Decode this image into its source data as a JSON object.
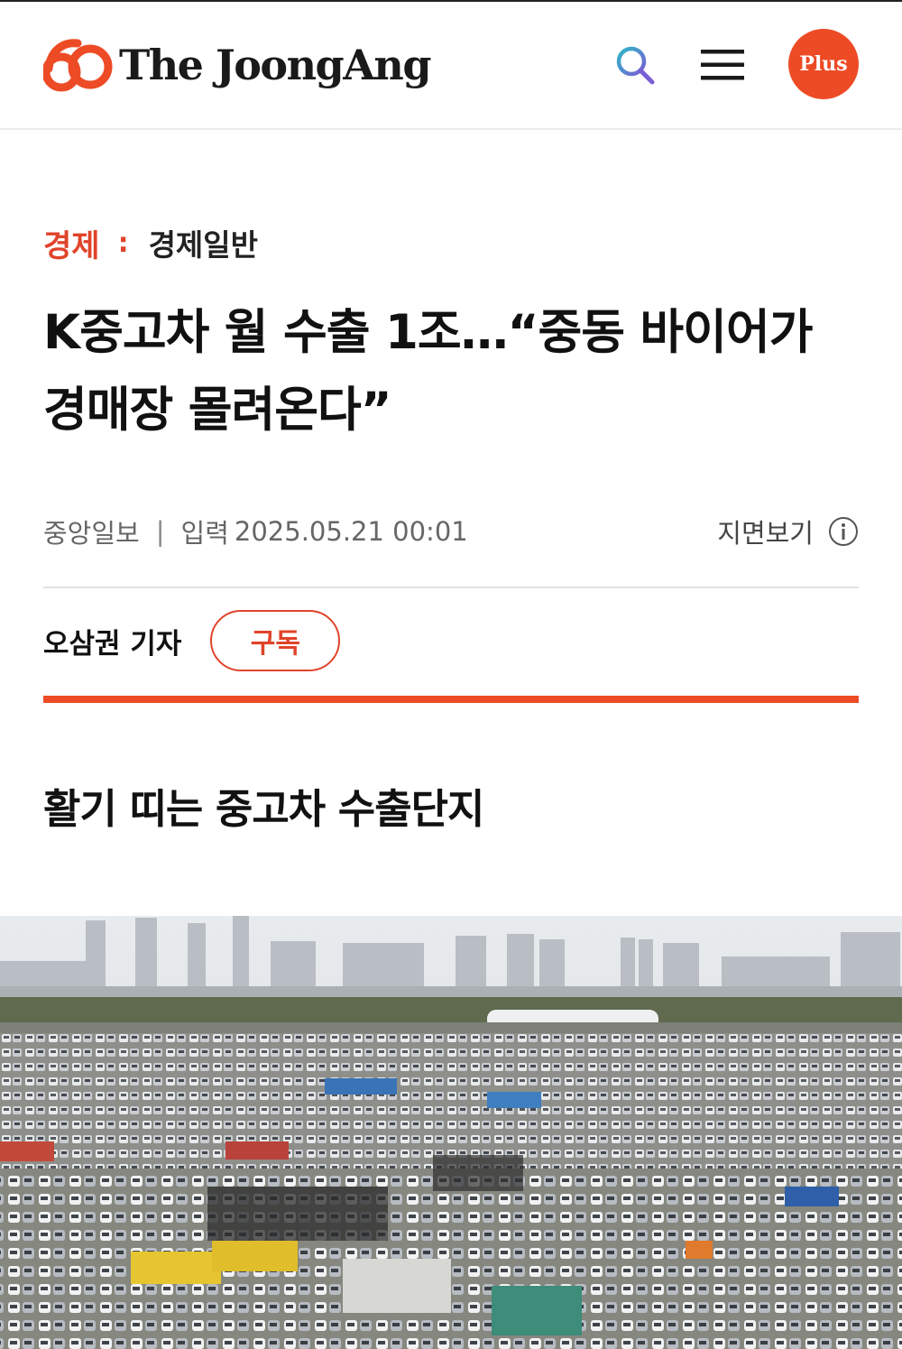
{
  "header": {
    "logo_number": "60",
    "logo_text": "The JoongAng",
    "search_icon": "search-icon",
    "menu_icon": "hamburger-menu-icon",
    "plus_label": "Plus",
    "colors": {
      "brand": "#ed4b25",
      "search_teal": "#2fb7c6",
      "search_purple": "#7a5fd6"
    }
  },
  "article": {
    "section": "경제",
    "separator": ":",
    "subsection": "경제일반",
    "headline": "K중고차 월 수출 1조…“중동 바이어가 경매장 몰려온다”",
    "source": "중앙일보",
    "meta_separator": "|",
    "date_label": "입력",
    "date": "2025.05.21 00:01",
    "print_view_label": "지면보기",
    "reporter": "오삼권 기자",
    "subscribe_label": "구독",
    "subheading": "활기 띠는 중고차 수출단지",
    "photo": "aerial-used-car-export-lot-photo"
  }
}
